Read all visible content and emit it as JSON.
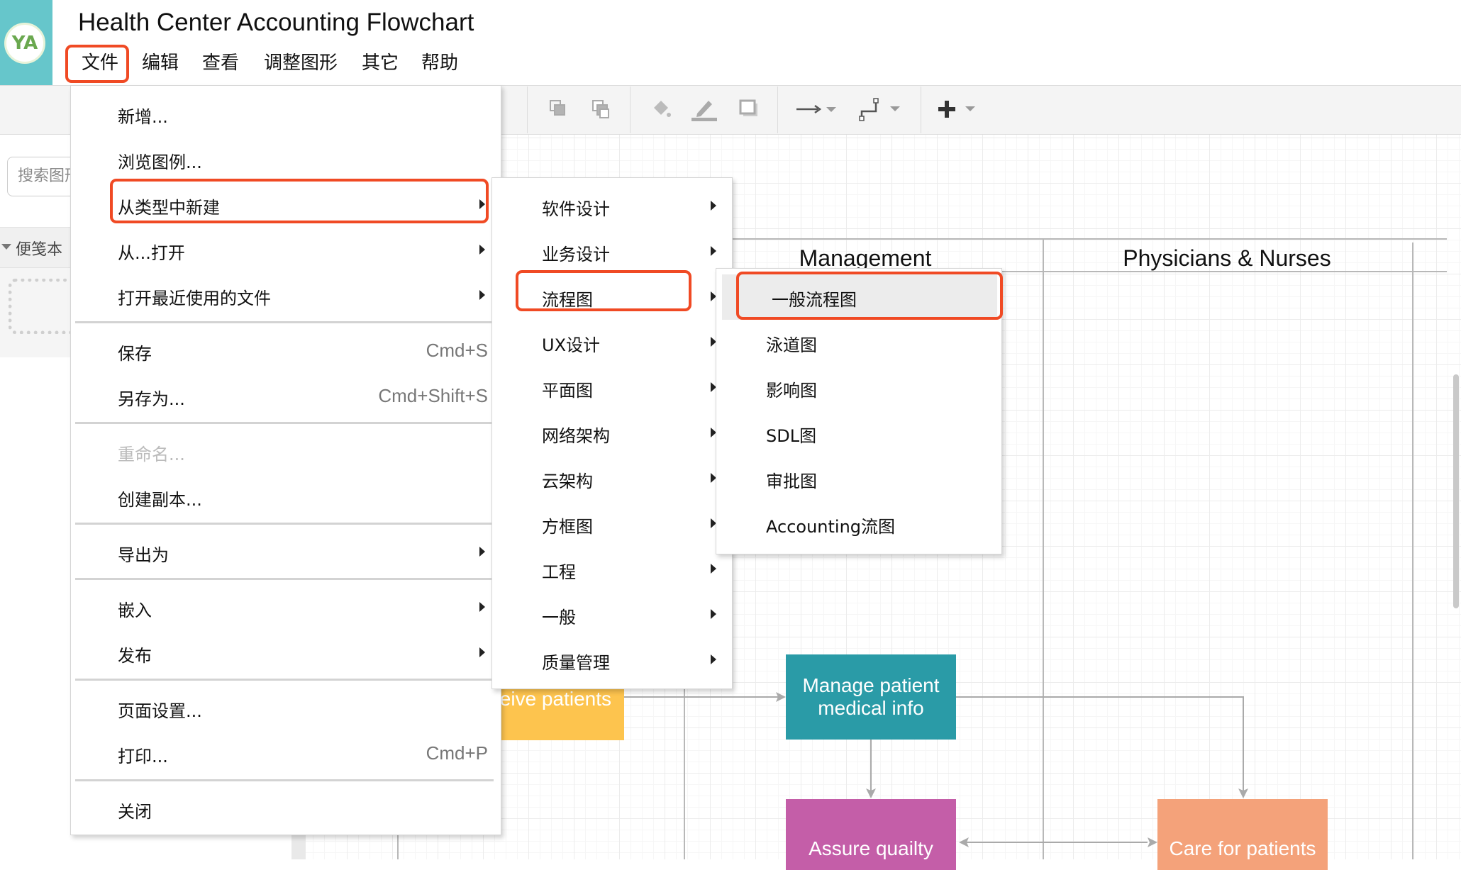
{
  "app": {
    "title": "Health Center Accounting Flowchart",
    "avatar_initials": "YA",
    "accent_color": "#66c6cb",
    "highlight_color": "#f04a24"
  },
  "menubar": {
    "items": [
      {
        "label": "文件",
        "active": true
      },
      {
        "label": "编辑"
      },
      {
        "label": "查看"
      },
      {
        "label": "调整图形"
      },
      {
        "label": "其它"
      },
      {
        "label": "帮助"
      }
    ]
  },
  "toolbar": {
    "icons": [
      "to-front-icon",
      "to-back-icon",
      "fill-color-icon",
      "line-color-icon",
      "shadow-icon",
      "connection-arrow-icon",
      "waypoint-style-icon",
      "insert-plus-icon"
    ]
  },
  "sidebar": {
    "search_placeholder": "搜索图形",
    "scratchpad_label": "便笺本"
  },
  "file_menu": {
    "items": [
      {
        "label": "新增..."
      },
      {
        "label": "浏览图例..."
      },
      {
        "label": "从类型中新建",
        "submenu": true,
        "highlighted": true
      },
      {
        "label": "从...打开",
        "submenu": true
      },
      {
        "label": "打开最近使用的文件",
        "submenu": true
      },
      {
        "label": "保存",
        "shortcut": "Cmd+S"
      },
      {
        "label": "另存为...",
        "shortcut": "Cmd+Shift+S"
      },
      {
        "label": "重命名...",
        "disabled": true
      },
      {
        "label": "创建副本..."
      },
      {
        "label": "导出为",
        "submenu": true
      },
      {
        "label": "嵌入",
        "submenu": true
      },
      {
        "label": "发布",
        "submenu": true
      },
      {
        "label": "页面设置..."
      },
      {
        "label": "打印...",
        "shortcut": "Cmd+P"
      },
      {
        "label": "关闭"
      }
    ]
  },
  "type_submenu": {
    "items": [
      {
        "label": "软件设计"
      },
      {
        "label": "业务设计"
      },
      {
        "label": "流程图",
        "highlighted": true
      },
      {
        "label": "UX设计"
      },
      {
        "label": "平面图"
      },
      {
        "label": "网络架构"
      },
      {
        "label": "云架构"
      },
      {
        "label": "方框图"
      },
      {
        "label": "工程"
      },
      {
        "label": "一般"
      },
      {
        "label": "质量管理"
      }
    ]
  },
  "flowchart_submenu": {
    "items": [
      {
        "label": "一般流程图",
        "highlighted": true
      },
      {
        "label": "泳道图"
      },
      {
        "label": "影响图"
      },
      {
        "label": "SDL图"
      },
      {
        "label": "审批图"
      },
      {
        "label": "Accounting流图"
      }
    ]
  },
  "diagram": {
    "lanes": [
      {
        "title": "Management"
      },
      {
        "title": "Physicians & Nurses"
      }
    ],
    "nodes": [
      {
        "label": "Receive patients",
        "visible_text": "eive patients",
        "color": "#fdc44e"
      },
      {
        "label": "Manage patient medical info",
        "color": "#2a9ba7"
      },
      {
        "label": "Assure quailty",
        "color": "#c45ea8"
      },
      {
        "label": "Care for patients",
        "color": "#f4a27a"
      }
    ]
  }
}
